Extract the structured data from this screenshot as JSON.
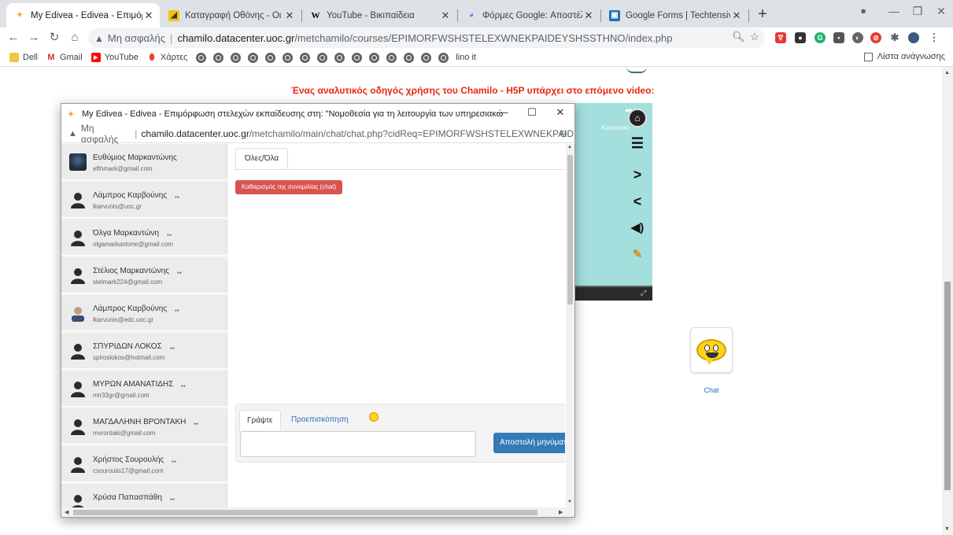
{
  "tabs": [
    {
      "title": "My Edivea - Edivea - Επιμόρφωσ",
      "active": true
    },
    {
      "title": "Καταγραφή Οθόνης - Οι Καλύτε",
      "active": false
    },
    {
      "title": "YouTube - Βικιπαίδεια",
      "active": false
    },
    {
      "title": "Φόρμες Google: Αποστέλλοντας",
      "active": false
    },
    {
      "title": "Google Forms | Techtensivist",
      "active": false
    }
  ],
  "toolbar": {
    "not_secure": "Μη ασφαλής",
    "url_host": "chamilo.datacenter.uoc.gr",
    "url_path": "/metchamilo/courses/EPIMORFWSHSTELEXWNEKPAIDEYSHSSTHNO/index.php"
  },
  "bookmarks": {
    "items": [
      "Dell",
      "Gmail",
      "YouTube",
      "Χάρτες"
    ],
    "globe_count": 15,
    "last": "lino it",
    "reading_list": "Λίστα ανάγνωσης"
  },
  "page": {
    "heading": "Ένας αναλυτικός οδηγός χρήσης του Chamilo - H5P υπάρχει στο επόμενο video:",
    "video_share": "Κοινοποίη",
    "chat_tool_label": "Chat"
  },
  "popup": {
    "title": "My Edivea - Edivea - Επιμόρφωση στελεχών εκπαίδευσης στη: \"Νομοθεσία για τη λειτουργία των υπηρεσιακών συμβουλί...",
    "not_secure": "Μη ασφαλής",
    "url_host": "chamilo.datacenter.uoc.gr",
    "url_path": "/metchamilo/main/chat/chat.php?cidReq=EPIMORFWSHSTELEXWNEKPAIDEYS...",
    "users": [
      {
        "name": "Ευθύμιος Μαρκαντώνης",
        "email": "efthmark@gmail.com",
        "avatar": "photo-dark"
      },
      {
        "name": "Λάμπρος Καρβούνης",
        "email": "lkarvunis@uoc.gr",
        "avatar": "default"
      },
      {
        "name": "Όλγα Μαρκαντώνη",
        "email": "olgamarkantone@gmail.com",
        "avatar": "default"
      },
      {
        "name": "Στέλιος Μαρκαντώνης",
        "email": "stelmark224@gmail.com",
        "avatar": "default"
      },
      {
        "name": "Λάμπρος Καρβούνης",
        "email": "lkarvunis@edc.uoc.gr",
        "avatar": "photo"
      },
      {
        "name": "ΣΠΥΡΙΔΩΝ ΛΟΚΟΣ",
        "email": "spiroslokos@hotmail.com",
        "avatar": "default"
      },
      {
        "name": "ΜΥΡΩΝ ΑΜΑΝΑΤΙΔΗΣ",
        "email": "mir33gr@gmail.com",
        "avatar": "default"
      },
      {
        "name": "ΜΑΓΔΑΛΗΝΗ ΒΡΟΝΤΑΚΗ",
        "email": "mvrontaki@gmail.com",
        "avatar": "default"
      },
      {
        "name": "Χρήστος Σουρουλής",
        "email": "csourouiis17@gmail.com",
        "avatar": "default"
      },
      {
        "name": "Χρύσα Παπασπάθη",
        "email": "",
        "avatar": "default"
      }
    ],
    "chat_tab": "Όλες/Όλα",
    "clear_button": "Καθαρισμός της συνομιλίας (chat)",
    "write_tab": "Γράψτε",
    "preview_tab": "Προεπισκόπηση",
    "send_button": "Αποστολή μηνύματος"
  }
}
